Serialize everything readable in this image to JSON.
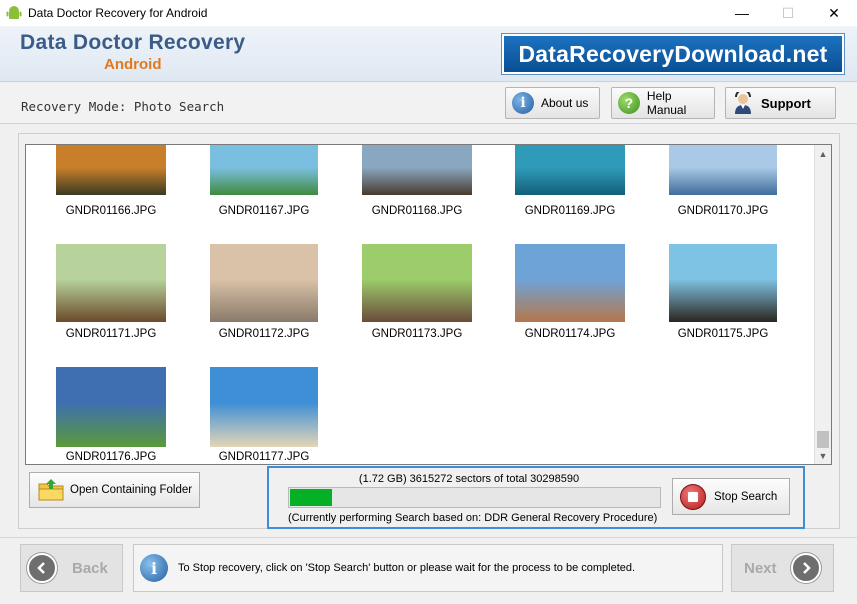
{
  "window": {
    "title": "Data Doctor Recovery for Android",
    "controls": {
      "minimize": "—",
      "maximize": "☐",
      "close": "✕"
    }
  },
  "banner": {
    "brand_main": "Data Doctor Recovery",
    "brand_sub": "Android",
    "site": "DataRecoveryDownload.net"
  },
  "toolbar": {
    "mode": "Recovery Mode: Photo Search",
    "about": "About us",
    "help": "Help Manual",
    "support": "Support"
  },
  "gallery": {
    "items": [
      {
        "name": "GNDR01166.JPG",
        "icon": "sunset-landscape-photo",
        "colors": [
          "#c97f2a",
          "#3b3a22"
        ]
      },
      {
        "name": "GNDR01167.JPG",
        "icon": "tropical-beach-photo",
        "colors": [
          "#7bbfe0",
          "#3f8a3f"
        ]
      },
      {
        "name": "GNDR01168.JPG",
        "icon": "harbor-boats-photo",
        "colors": [
          "#8aa7c2",
          "#4a3a2c"
        ]
      },
      {
        "name": "GNDR01169.JPG",
        "icon": "dolphins-photo",
        "colors": [
          "#2f9bb8",
          "#135f7a"
        ]
      },
      {
        "name": "GNDR01170.JPG",
        "icon": "marina-photo",
        "colors": [
          "#a9c9e6",
          "#3f6c9a"
        ]
      },
      {
        "name": "GNDR01171.JPG",
        "icon": "gazebo-photo",
        "colors": [
          "#b7d39b",
          "#6b4a2a"
        ]
      },
      {
        "name": "GNDR01172.JPG",
        "icon": "bride-beach-photo",
        "colors": [
          "#d9c2a8",
          "#8a7a6a"
        ]
      },
      {
        "name": "GNDR01173.JPG",
        "icon": "group-selfie-photo",
        "colors": [
          "#9ccd6a",
          "#6a4b3a"
        ]
      },
      {
        "name": "GNDR01174.JPG",
        "icon": "city-square-photo",
        "colors": [
          "#6ea3d8",
          "#b5774a"
        ]
      },
      {
        "name": "GNDR01175.JPG",
        "icon": "sea-cave-photo",
        "colors": [
          "#7fc3e4",
          "#2b2620"
        ]
      },
      {
        "name": "GNDR01176.JPG",
        "icon": "green-hills-photo",
        "colors": [
          "#3f6fb0",
          "#5a9a3a"
        ]
      },
      {
        "name": "GNDR01177.JPG",
        "icon": "rock-arch-beach-photo",
        "colors": [
          "#3f8fd6",
          "#e4d6b6"
        ]
      }
    ]
  },
  "actions": {
    "open_folder": "Open Containing Folder",
    "stop_search": "Stop Search"
  },
  "progress": {
    "stats": "(1.72 GB) 3615272  sectors  of  total 30298590",
    "sectors_done": 3615272,
    "sectors_total": 30298590,
    "status": "(Currently performing Search based on:  DDR General Recovery Procedure)"
  },
  "nav": {
    "back": "Back",
    "next": "Next",
    "info": "To Stop recovery, click on 'Stop Search' button or please wait for the process to be completed."
  }
}
